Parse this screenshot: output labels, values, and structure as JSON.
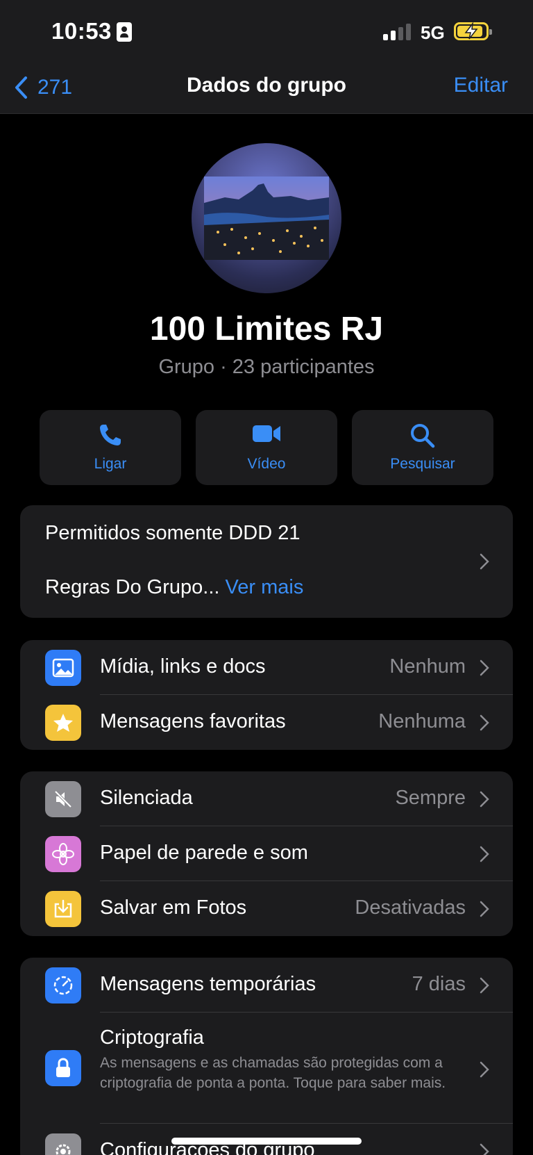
{
  "status": {
    "time": "10:53",
    "network": "5G"
  },
  "nav": {
    "back_label": "271",
    "title": "Dados do grupo",
    "edit_label": "Editar"
  },
  "group": {
    "name": "100 Limites RJ",
    "subtitle": "Grupo · 23 participantes"
  },
  "actions": [
    {
      "label": "Ligar",
      "icon": "phone-icon"
    },
    {
      "label": "Vídeo",
      "icon": "video-icon"
    },
    {
      "label": "Pesquisar",
      "icon": "search-icon"
    }
  ],
  "description": {
    "line1": "Permitidos somente DDD 21",
    "line2": "Regras Do Grupo...",
    "more": "Ver mais"
  },
  "section_media": [
    {
      "label": "Mídia, links e docs",
      "value": "Nenhum",
      "icon": "photo-icon",
      "color": "#2f7cf6"
    },
    {
      "label": "Mensagens favoritas",
      "value": "Nenhuma",
      "icon": "star-icon",
      "color": "#f4c43b"
    }
  ],
  "section_settings": [
    {
      "label": "Silenciada",
      "value": "Sempre",
      "icon": "mute-icon",
      "color": "#8e8e93"
    },
    {
      "label": "Papel de parede e som",
      "value": "",
      "icon": "flower-icon",
      "color": "#d778d6"
    },
    {
      "label": "Salvar em Fotos",
      "value": "Desativadas",
      "icon": "save-download-icon",
      "color": "#f4c43b"
    }
  ],
  "section_privacy": {
    "temporary": {
      "label": "Mensagens temporárias",
      "value": "7 dias",
      "icon": "timer-icon",
      "color": "#2f7cf6"
    },
    "crypto": {
      "label": "Criptografia",
      "description": "As mensagens e as chamadas são protegidas com a criptografia de ponta a ponta. Toque para saber mais.",
      "icon": "lock-icon",
      "color": "#2f7cf6"
    },
    "group_settings": {
      "label": "Configurações do grupo",
      "icon": "gear-icon",
      "color": "#8e8e93"
    }
  }
}
